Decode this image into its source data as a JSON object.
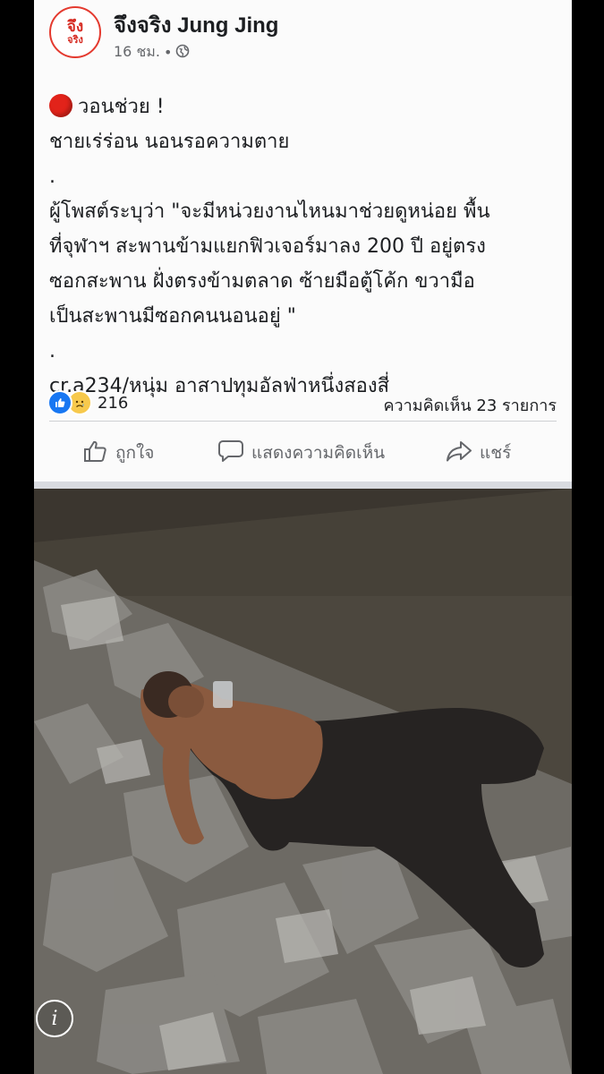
{
  "post": {
    "page_name": "จึงจริง Jung Jing",
    "avatar_text_top": "จึง",
    "avatar_text_bottom": "จริง",
    "time": "16 ชม.",
    "separator": "•",
    "lines": [
      "วอนช่วย !",
      "ชายเร่ร่อน นอนรอความตาย",
      ".",
      "ผู้โพสต์ระบุว่า \"จะมีหน่วยงานไหนมาช่วยดูหน่อย พื้น",
      "ที่จุฬาฯ สะพานข้ามแยกฟิวเจอร์มาลง 200 ปี อยู่ตรง",
      "ซอกสะพาน ฝั่งตรงข้ามตลาด ซ้ายมือตู้โค้ก ขวามือ",
      "เป็นสะพานมีซอกคนนอนอยู่ \"",
      ".",
      "cr.a234/หนุ่ม อาสาปทุมอัลฟ่าหนึ่งสองสี่"
    ],
    "reaction_count": "216",
    "comments_label": "ความคิดเห็น 23 รายการ"
  },
  "actions": {
    "like": "ถูกใจ",
    "comment": "แสดงความคิดเห็น",
    "share": "แชร์"
  },
  "photo": {
    "info_glyph": "i"
  },
  "colors": {
    "accent_blue": "#1877f2",
    "alert_red": "#e2231a",
    "brand_red": "#d62b22"
  }
}
